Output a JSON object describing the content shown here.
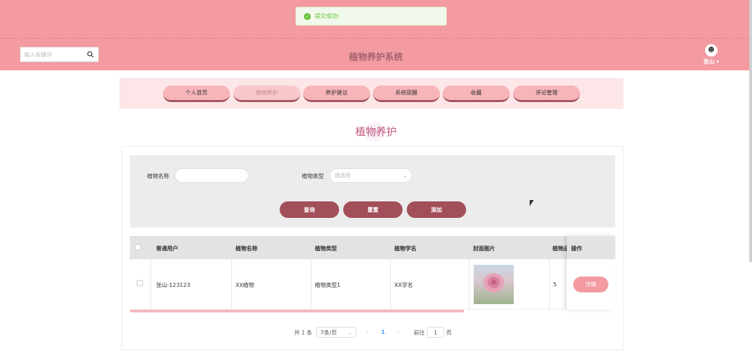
{
  "toast": {
    "message": "提交成功!",
    "icon": "check-circle-icon",
    "color": "#67c23a"
  },
  "header": {
    "search_placeholder": "输入关键词",
    "title": "植物养护系统",
    "user_name": "张山",
    "bg_color": "#f39ba1"
  },
  "nav": {
    "items": [
      {
        "label": "个人首页"
      },
      {
        "label": "植物养护"
      },
      {
        "label": "养护建议"
      },
      {
        "label": "系统提醒"
      },
      {
        "label": "收藏"
      },
      {
        "label": "评论管理"
      }
    ],
    "active_index": 1
  },
  "page_title": "植物养护",
  "filter": {
    "name_label": "植物名称",
    "name_value": "",
    "type_label": "植物类型",
    "type_placeholder": "请选择",
    "buttons": {
      "query": "查询",
      "reset": "重置",
      "add": "添加"
    }
  },
  "table": {
    "headers": [
      "普通用户",
      "植物名称",
      "植物类型",
      "植物学名",
      "封面图片",
      "植物品",
      "操作"
    ],
    "rows": [
      {
        "user": "张山-123123",
        "name": "XX植物",
        "type": "植物类型1",
        "sci_name": "XX学名",
        "image": "rose-photo",
        "extra": "5",
        "action": "详情"
      }
    ]
  },
  "pagination": {
    "total": "共 1 条",
    "page_size": "7条/页",
    "current_page": "1",
    "goto_label": "前往",
    "goto_value": "1",
    "page_suffix": "页"
  }
}
